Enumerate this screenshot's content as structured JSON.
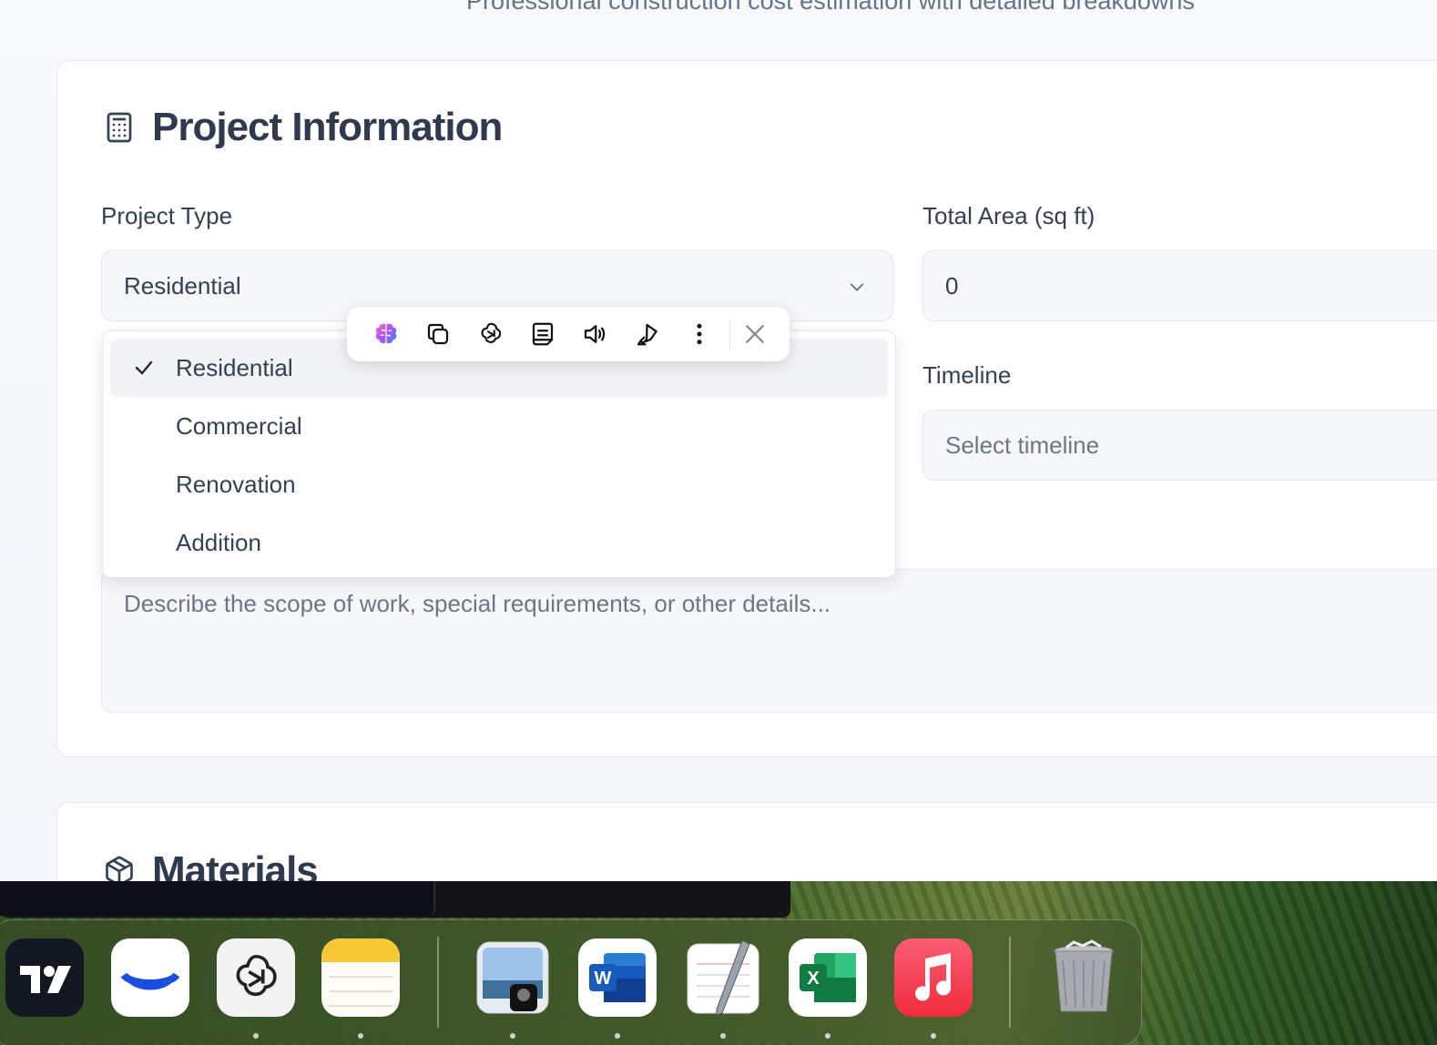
{
  "header": {
    "subtitle": "Professional construction cost estimation with detailed breakdowns"
  },
  "project_card": {
    "title": "Project Information",
    "project_type": {
      "label": "Project Type",
      "value": "Residential"
    },
    "total_area": {
      "label": "Total Area (sq ft)",
      "value": "0"
    },
    "timeline": {
      "label": "Timeline",
      "placeholder": "Select timeline"
    },
    "description": {
      "placeholder": "Describe the scope of work, special requirements, or other details..."
    }
  },
  "project_type_options": [
    {
      "label": "Residential",
      "selected": true
    },
    {
      "label": "Commercial",
      "selected": false
    },
    {
      "label": "Renovation",
      "selected": false
    },
    {
      "label": "Addition",
      "selected": false
    }
  ],
  "materials_card": {
    "title": "Materials"
  },
  "floating_toolbar": {
    "icons": [
      "brain-icon",
      "copy-icon",
      "chatgpt-icon",
      "summary-icon",
      "speaker-icon",
      "highlighter-icon",
      "more-icon",
      "close-icon"
    ]
  },
  "dock": {
    "apps": [
      "TradingView",
      "Coinbase",
      "ChatGPT",
      "Notes",
      "Preview",
      "Microsoft Word",
      "TextEdit",
      "Microsoft Excel",
      "Music",
      "Trash"
    ],
    "colors": {
      "accent_word": "#2b5fd0",
      "accent_excel": "#1f7a45",
      "accent_music": "#f0424f"
    }
  }
}
